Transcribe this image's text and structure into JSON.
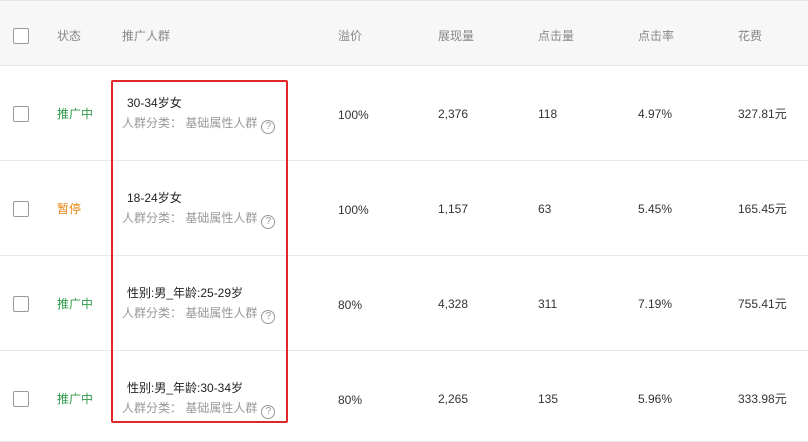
{
  "header": {
    "status": "状态",
    "crowd": "推广人群",
    "premium": "溢价",
    "impressions": "展现量",
    "clicks": "点击量",
    "ctr": "点击率",
    "cost": "花费"
  },
  "rows": [
    {
      "status": "推广中",
      "status_type": "active",
      "crowd_name": "30-34岁女",
      "crowd_category": "人群分类： 基础属性人群",
      "premium": "100%",
      "impressions": "2,376",
      "clicks": "118",
      "ctr": "4.97%",
      "cost": "327.81元"
    },
    {
      "status": "暂停",
      "status_type": "paused",
      "crowd_name": "18-24岁女",
      "crowd_category": "人群分类： 基础属性人群",
      "premium": "100%",
      "impressions": "1,157",
      "clicks": "63",
      "ctr": "5.45%",
      "cost": "165.45元"
    },
    {
      "status": "推广中",
      "status_type": "active",
      "crowd_name": "性别:男_年龄:25-29岁",
      "crowd_category": "人群分类： 基础属性人群",
      "premium": "80%",
      "impressions": "4,328",
      "clicks": "311",
      "ctr": "7.19%",
      "cost": "755.41元"
    },
    {
      "status": "推广中",
      "status_type": "active",
      "crowd_name": "性别:男_年龄:30-34岁",
      "crowd_category": "人群分类： 基础属性人群",
      "premium": "80%",
      "impressions": "2,265",
      "clicks": "135",
      "ctr": "5.96%",
      "cost": "333.98元"
    }
  ],
  "help_glyph": "?",
  "colors": {
    "active": "#2f9a4a",
    "paused": "#e8830e",
    "highlight": "#e0282a"
  }
}
